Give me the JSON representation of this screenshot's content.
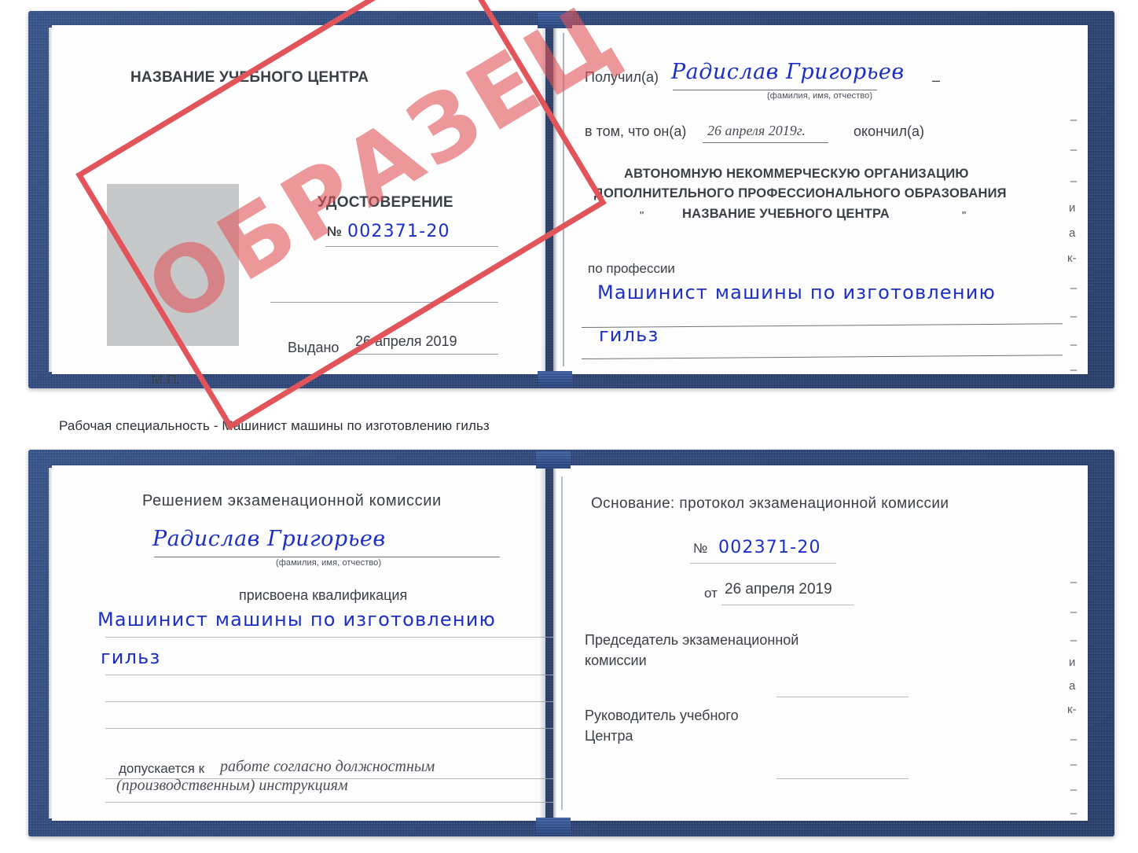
{
  "caption": "Рабочая специальность - Машинист машины по изготовлению гильз",
  "stamp": {
    "text": "ОБРАЗЕЦ",
    "color": "#e1555a"
  },
  "top_spread": {
    "left_page": {
      "center_name": "НАЗВАНИЕ УЧЕБНОГО ЦЕНТРА",
      "doc_title": "УДОСТОВЕРЕНИЕ",
      "number_label": "№",
      "number_value": "002371-20",
      "issued_label": "Выдано",
      "issued_value": "26 апреля 2019",
      "seal_label": "М.П."
    },
    "right_page": {
      "received_label": "Получил(а)",
      "received_value": "Радислав Григорьев",
      "fio_hint": "(фамилия, имя, отчество)",
      "that_he_label": "в том, что он(а)",
      "date_value": "26 апреля 2019г.",
      "finished_label": "окончил(а)",
      "org_line1": "АВТОНОМНУЮ НЕКОММЕРЧЕСКУЮ ОРГАНИЗАЦИЮ",
      "org_line2": "ДОПОЛНИТЕЛЬНОГО ПРОФЕССИОНАЛЬНОГО ОБРАЗОВАНИЯ",
      "org_quote_open": "\"",
      "org_name": "НАЗВАНИЕ УЧЕБНОГО ЦЕНТРА",
      "org_quote_close": "\"",
      "profession_label": "по профессии",
      "profession_value_line1": "Машинист машины по изготовлению",
      "profession_value_line2": "гильз"
    }
  },
  "bottom_spread": {
    "left_page": {
      "decision_title": "Решением экзаменационной комиссии",
      "name_value": "Радислав Григорьев",
      "fio_hint": "(фамилия, имя, отчество)",
      "qualification_label": "присвоена квалификация",
      "qualification_line1": "Машинист машины по изготовлению",
      "qualification_line2": "гильз",
      "admitted_label": "допускается к",
      "admitted_value_line1": "работе согласно должностным",
      "admitted_value_line2": "(производственным) инструкциям"
    },
    "right_page": {
      "basis_label": "Основание: протокол экзаменационной комиссии",
      "number_label": "№",
      "number_value": "002371-20",
      "date_label": "от",
      "date_value": "26 апреля 2019",
      "chairman_line1": "Председатель экзаменационной",
      "chairman_line2": "комиссии",
      "head_line1": "Руководитель учебного",
      "head_line2": "Центра"
    }
  },
  "margin_fragments_top": [
    "–",
    "–",
    "–",
    "и",
    "а",
    "к-",
    "–",
    "–",
    "–",
    "–"
  ],
  "margin_fragments_bottom": [
    "–",
    "–",
    "–",
    "и",
    "а",
    "к-",
    "–",
    "–",
    "–",
    "–"
  ]
}
